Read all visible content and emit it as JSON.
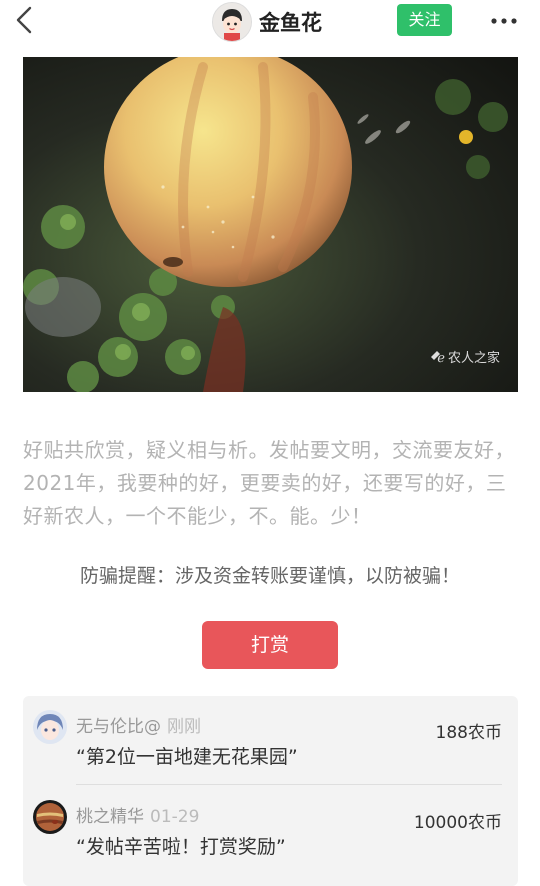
{
  "header": {
    "title": "金鱼花",
    "follow_label": "关注"
  },
  "photo": {
    "watermark": "农人之家"
  },
  "post": {
    "paragraph": "好贴共欣赏，疑义相与析。发帖要文明，交流要友好，2021年，我要种的好，更要卖的好，还要写的好，三好新农人，一个不能少，不。能。少！",
    "warning": "防骗提醒：涉及资金转账要谨慎，以防被骗！"
  },
  "reward_button": "打赏",
  "rewards": [
    {
      "name": "无与伦比@",
      "time": "刚刚",
      "message": "“第2位一亩地建无花果园”",
      "amount": "188农币"
    },
    {
      "name": "桃之精华",
      "time": "01-29",
      "message": "“发帖辛苦啦！打赏奖励”",
      "amount": "10000农币"
    }
  ],
  "colors": {
    "follow_green": "#2fc06a",
    "reward_red": "#e8565a"
  }
}
